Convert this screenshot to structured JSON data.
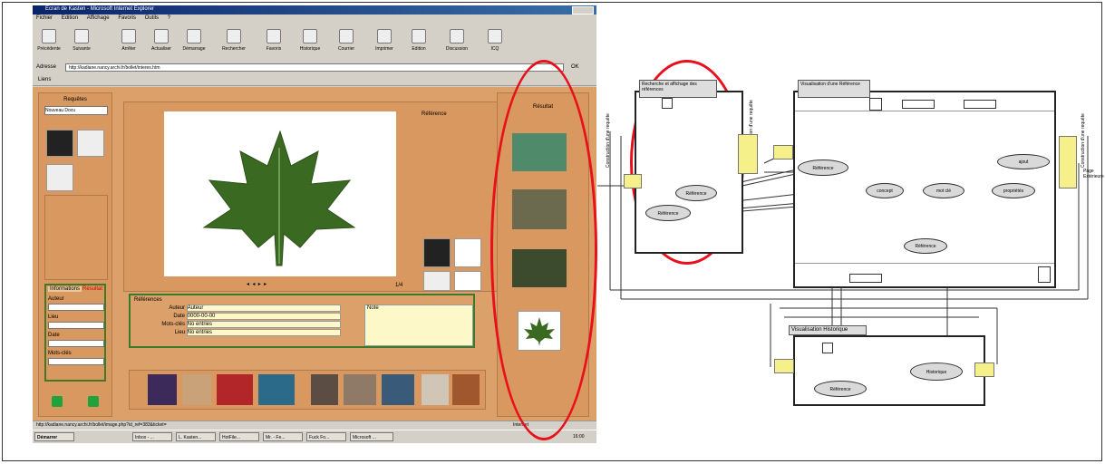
{
  "browser": {
    "title": "Ecran de Kasten - Microsoft Internet Explorer",
    "menu": [
      "Fichier",
      "Edition",
      "Affichage",
      "Favoris",
      "Outils",
      "?"
    ],
    "toolbar": [
      "Précédente",
      "Suivante",
      "Arrêter",
      "Actualiser",
      "Démarrage",
      "Rechercher",
      "Favoris",
      "Historique",
      "Courrier",
      "Imprimer",
      "Edition",
      "Discussion",
      "ICQ"
    ],
    "address_label": "Adresse",
    "address_value": "http://kadiane.nancy.archi.fr/bollet/interes.htm",
    "go_label": "OK",
    "links_label": "Liens",
    "status_left": "http://kadiane.nancy.archi.fr/bollet/image.php?id_ref=383&ticket=",
    "status_right": "Internet",
    "taskbar": [
      "Démarrer",
      "Inbox - ...",
      "L. Kasten...",
      "HotFile...",
      "Mr. - Fe...",
      "Fuck Fo...",
      "Microsoft ..."
    ],
    "clock": "16:00"
  },
  "app": {
    "requests_title": "Requêtes",
    "requests_select": "Nouveau Docu",
    "reference_title": "Référence",
    "result_title": "Résultat",
    "ref_info_title": "Références",
    "fields": [
      {
        "label": "Auteur",
        "value": "Auteur"
      },
      {
        "label": "Date",
        "value": "0000-00-00"
      },
      {
        "label": "Mots-clés",
        "value": "No entries"
      },
      {
        "label": "Lieu",
        "value": "No entries"
      }
    ],
    "note": "Note",
    "tabs": [
      "Informations",
      "Résultat"
    ],
    "left_form": [
      "Auteur",
      "Lieu",
      "Date",
      "Mots-clés"
    ],
    "nav": [
      "◂",
      "◂",
      "▸",
      "▸"
    ],
    "page_counter": "1/4"
  },
  "diagram": {
    "recherche_box": "Recherche et affichage des références",
    "visualisation_ref": "Visualisation d'une Référence",
    "visualisation_hist": "Visualisation Historique",
    "construction_left": "Construction d'une requête",
    "construction_mid": "Construction d'une requête",
    "construction_right": "Construction d'une requête",
    "page_outside": "Page Extérieure",
    "ellipses": {
      "r1": "Référence",
      "r2": "Référence",
      "ref_main": "Référence",
      "concept": "concept",
      "mot_cle": "mot clé",
      "proprietes": "propriétés",
      "ajout": "ajout",
      "ref_bottom": "Référence",
      "hist_ref": "Historique",
      "hist_rep": "Référence"
    }
  },
  "colors": {
    "app_bg": "#dca06a",
    "accent_red": "#e8101b",
    "link_yellow": "#f6f08a",
    "leaf": "#3a6a22"
  }
}
